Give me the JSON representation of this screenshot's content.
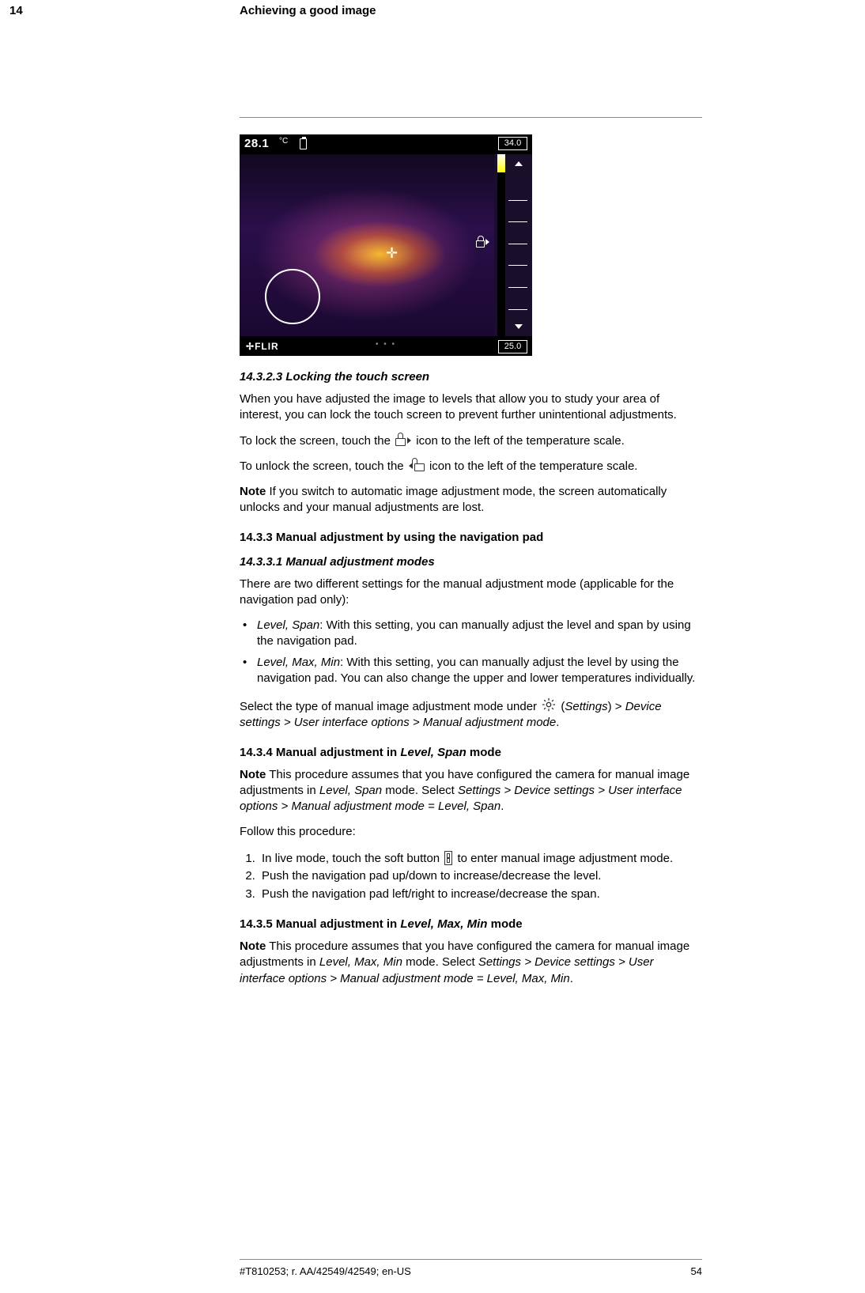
{
  "header": {
    "chapter": "14",
    "title": "Achieving a good image"
  },
  "figure": {
    "temp": "28.1",
    "unit": "°C",
    "scale_max": "34.0",
    "scale_min": "25.0",
    "brand": "FLIR"
  },
  "s14323": {
    "heading": "14.3.2.3    Locking the touch screen",
    "p1": "When you have adjusted the image to levels that allow you to study your area of interest, you can lock the touch screen to prevent further unintentional adjustments.",
    "p2a": "To lock the screen, touch the ",
    "p2b": " icon to the left of the temperature scale.",
    "p3a": "To unlock the screen, touch the ",
    "p3b": " icon to the left of the temperature scale.",
    "note_label": "Note",
    "note": "    If you switch to automatic image adjustment mode, the screen automatically unlocks and your manual adjustments are lost."
  },
  "s1433": {
    "heading": "14.3.3    Manual adjustment by using the navigation pad"
  },
  "s14331": {
    "heading": "14.3.3.1    Manual adjustment modes",
    "intro": "There are two different settings for the manual adjustment mode (applicable for the navigation pad only):",
    "b1_it": "Level, Span",
    "b1_rest": ": With this setting, you can manually adjust the level and span by using the navigation pad.",
    "b2_it": "Level, Max, Min",
    "b2_rest": ": With this setting, you can manually adjust the level by using the navigation pad. You can also change the upper and lower temperatures individually.",
    "sel1": "Select the type of manual image adjustment mode under ",
    "sel_settings": "Settings",
    "sel2": ") > ",
    "sel_path": "Device settings > User interface options > Manual adjustment mode",
    "sel3": "."
  },
  "s1434": {
    "heading_pre": "14.3.4    Manual adjustment in ",
    "heading_it": "Level, Span",
    "heading_post": " mode",
    "note_label": "Note",
    "note1a": "    This procedure assumes that you have configured the camera for manual image adjustments in ",
    "note1_it": "Level, Span",
    "note1b": " mode. Select ",
    "note1_path": "Settings > Device settings > User interface options > Manual adjustment mode = Level, Span",
    "note1c": ".",
    "follow": "Follow this procedure:",
    "step1a": "In live mode, touch the soft button ",
    "step1b": " to enter manual image adjustment mode.",
    "step2": "Push the navigation pad up/down to increase/decrease the level.",
    "step3": "Push the navigation pad left/right to increase/decrease the span."
  },
  "s1435": {
    "heading_pre": "14.3.5    Manual adjustment in ",
    "heading_it": "Level, Max, Min",
    "heading_post": " mode",
    "note_label": "Note",
    "note1a": "    This procedure assumes that you have configured the camera for manual image adjustments in ",
    "note1_it": "Level, Max, Min",
    "note1b": " mode. Select ",
    "note1_path": "Settings > Device settings > User interface options > Manual adjustment mode = Level, Max, Min",
    "note1c": "."
  },
  "footer": {
    "id": "#T810253; r. AA/42549/42549; en-US",
    "page": "54"
  }
}
